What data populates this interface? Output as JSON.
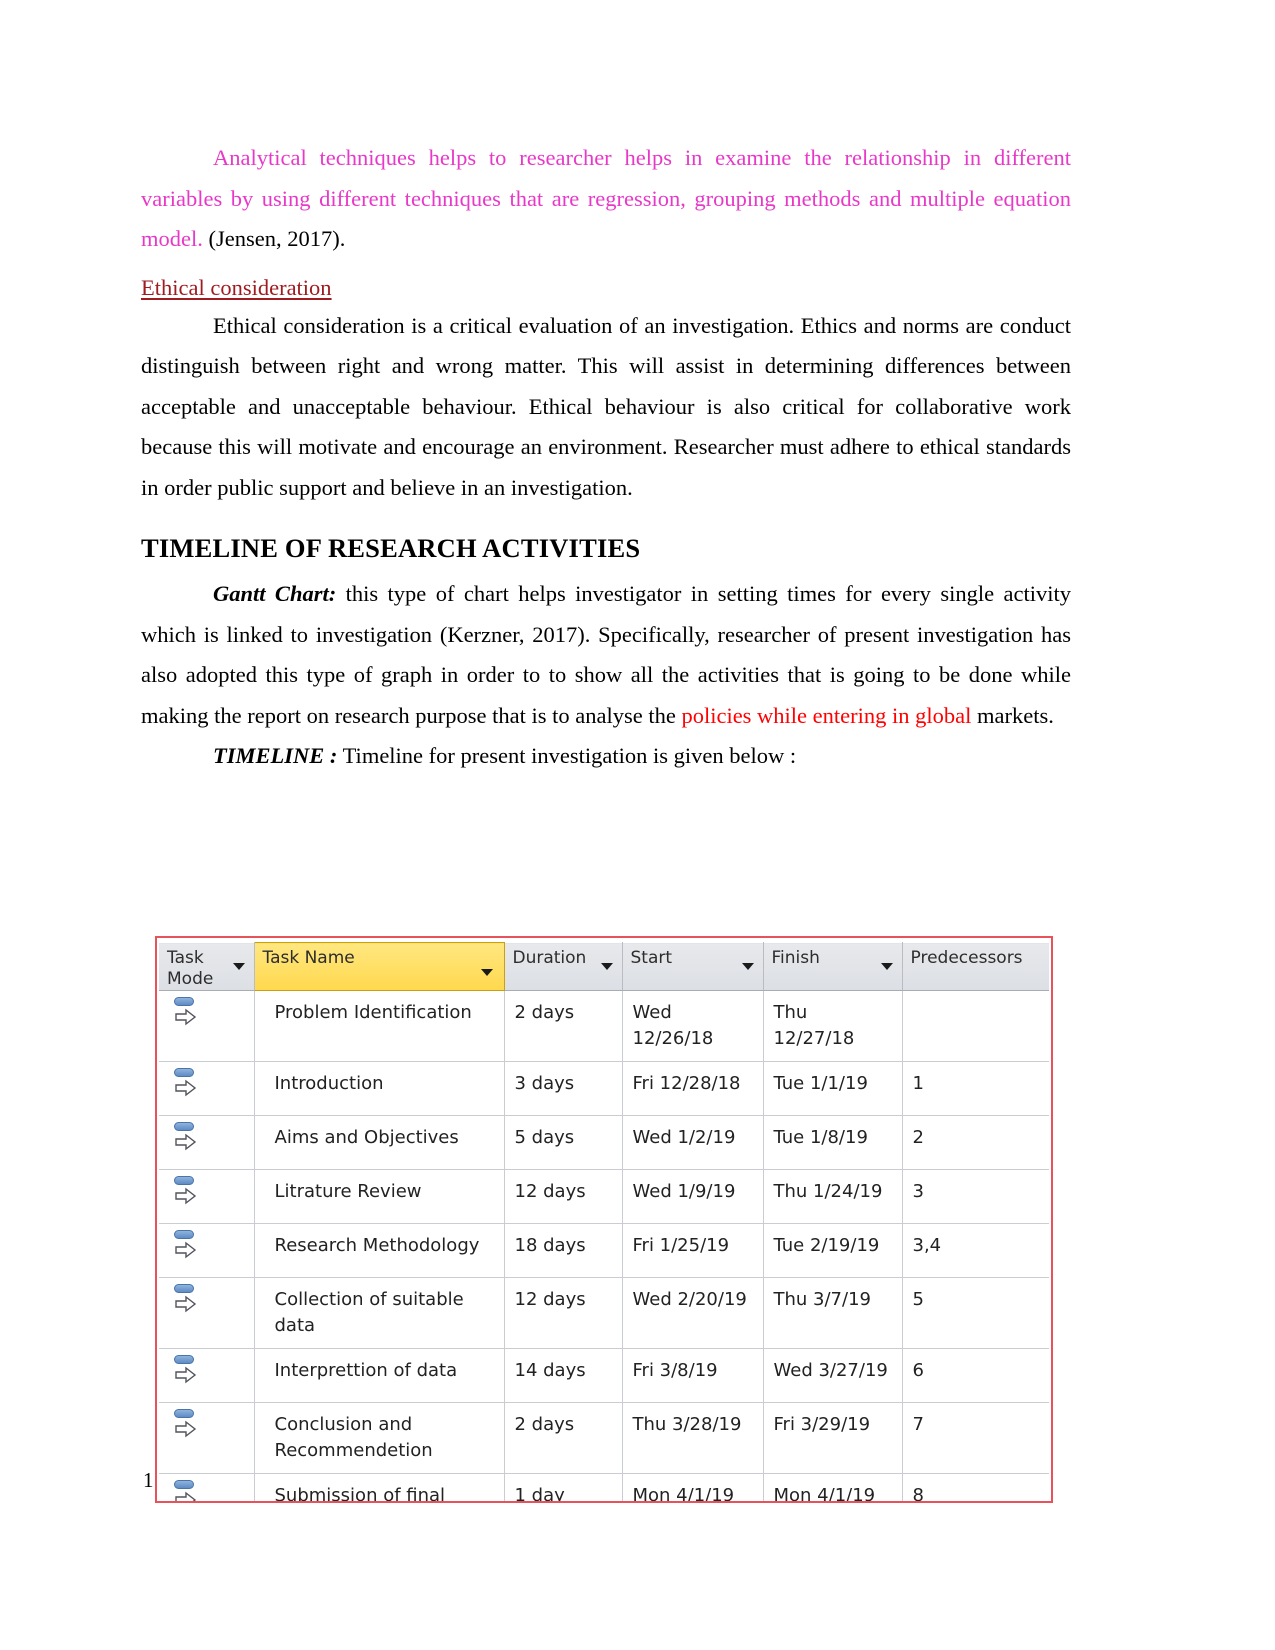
{
  "document": {
    "page_number": "1",
    "paragraphs": {
      "analytical": {
        "colored_part": "Analytical techniques helps to researcher helps in examine the relationship in different variables by using different techniques that are regression, grouping methods and multiple equation model.",
        "citation": " (Jensen, 2017)."
      },
      "ethical_heading": "Ethical consideration",
      "ethical_body": "Ethical consideration is a critical evaluation of an investigation. Ethics and norms are conduct distinguish between right and wrong matter. This will assist in determining differences between acceptable and unacceptable behaviour. Ethical behaviour is also critical for collaborative work because this will motivate and encourage an environment. Researcher must adhere to ethical standards in order public support and believe in an investigation.",
      "timeline_heading": "TIMELINE OF RESEARCH ACTIVITIES",
      "gantt_label": "Gantt Chart:",
      "gantt_body_1": "  this type of chart helps investigator in setting times for every single activity which is linked to investigation (Kerzner, 2017). Specifically, researcher of present investigation has also adopted this type of graph in order to to show all the activities that is going to be done while making the report on research purpose that is  to analyse the ",
      "gantt_body_red": "policies while entering in global",
      "gantt_body_2": " markets.",
      "timeline_label": "TIMELINE :",
      "timeline_body": " Timeline for present investigation  is given below :"
    },
    "colors": {
      "magenta": "#E838C8",
      "dark_red": "#9E1B20",
      "bright_red": "#FF0000",
      "black": "#000000",
      "screenshot_border": "#E8525B",
      "header_highlight": "#FFD84D"
    }
  },
  "gantt_table": {
    "columns": [
      {
        "key": "task_mode",
        "label": "Task Mode",
        "highlighted": false,
        "has_filter_arrow": true
      },
      {
        "key": "task_name",
        "label": "Task Name",
        "highlighted": true,
        "has_filter_arrow": true
      },
      {
        "key": "duration",
        "label": "Duration",
        "highlighted": false,
        "has_filter_arrow": true
      },
      {
        "key": "start",
        "label": "Start",
        "highlighted": false,
        "has_filter_arrow": true
      },
      {
        "key": "finish",
        "label": "Finish",
        "highlighted": false,
        "has_filter_arrow": true
      },
      {
        "key": "predecessors",
        "label": "Predecessors",
        "highlighted": false,
        "has_filter_arrow": false
      }
    ],
    "rows": [
      {
        "mode_icon": "auto-scheduled-icon",
        "task_name": "Problem Identification",
        "duration": "2 days",
        "start": "Wed 12/26/18",
        "finish": "Thu 12/27/18",
        "predecessors": ""
      },
      {
        "mode_icon": "auto-scheduled-icon",
        "task_name": "Introduction",
        "duration": "3 days",
        "start": "Fri 12/28/18",
        "finish": "Tue 1/1/19",
        "predecessors": "1"
      },
      {
        "mode_icon": "auto-scheduled-icon",
        "task_name": "Aims and Objectives",
        "duration": "5 days",
        "start": "Wed 1/2/19",
        "finish": "Tue 1/8/19",
        "predecessors": "2"
      },
      {
        "mode_icon": "auto-scheduled-icon",
        "task_name": "Litrature Review",
        "duration": "12 days",
        "start": "Wed 1/9/19",
        "finish": "Thu 1/24/19",
        "predecessors": "3"
      },
      {
        "mode_icon": "auto-scheduled-icon",
        "task_name": "Research Methodology",
        "duration": "18 days",
        "start": "Fri 1/25/19",
        "finish": "Tue 2/19/19",
        "predecessors": "3,4"
      },
      {
        "mode_icon": "auto-scheduled-icon",
        "task_name": "Collection of suitable data",
        "duration": "12 days",
        "start": "Wed 2/20/19",
        "finish": "Thu 3/7/19",
        "predecessors": "5"
      },
      {
        "mode_icon": "auto-scheduled-icon",
        "task_name": "Interprettion of data",
        "duration": "14 days",
        "start": "Fri 3/8/19",
        "finish": "Wed 3/27/19",
        "predecessors": "6"
      },
      {
        "mode_icon": "auto-scheduled-icon",
        "task_name": "Conclusion  and Recommendetion",
        "duration": "2 days",
        "start": "Thu 3/28/19",
        "finish": "Fri 3/29/19",
        "predecessors": "7"
      },
      {
        "mode_icon": "auto-scheduled-icon",
        "task_name": "Submission of final Report",
        "duration": "1 day",
        "start": "Mon 4/1/19",
        "finish": "Mon 4/1/19",
        "predecessors": "8"
      }
    ]
  }
}
